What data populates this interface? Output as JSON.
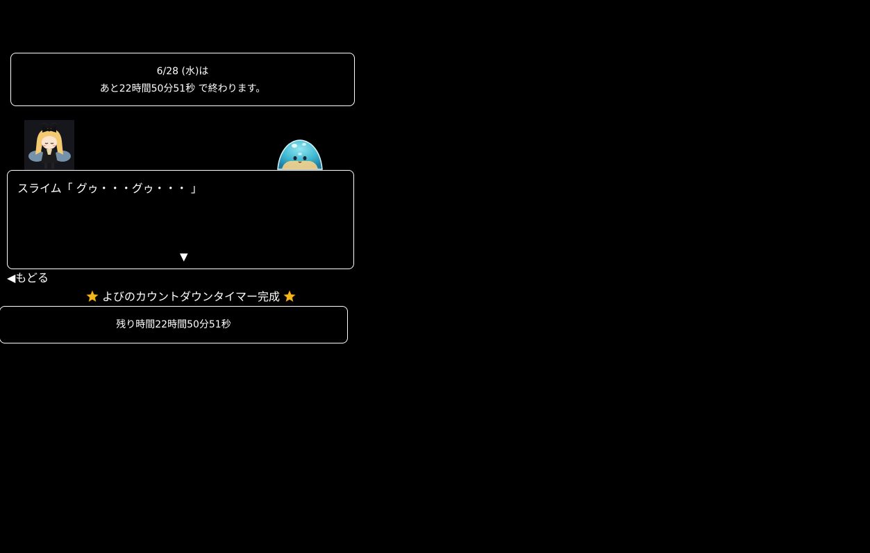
{
  "countdown": {
    "date_line": "6/28 (水)は",
    "remaining_line": "あと22時間50分51秒 で終わります。"
  },
  "dialog": {
    "speaker_text": "スライム「 グゥ・・・グゥ・・・ 」",
    "next_indicator": "▼"
  },
  "navigation": {
    "back_label": "◀もどる"
  },
  "footer": {
    "title": "よびのカウントダウンタイマー完成",
    "remaining_text": "残り時間22時間50分51秒"
  },
  "colors": {
    "background": "#000000",
    "text": "#ffffff",
    "border": "#ffffff",
    "star": "#f5b81c"
  },
  "icons": {
    "character": "fairy-girl-avatar",
    "enemy": "slime-character",
    "decoration": "star-icon"
  }
}
